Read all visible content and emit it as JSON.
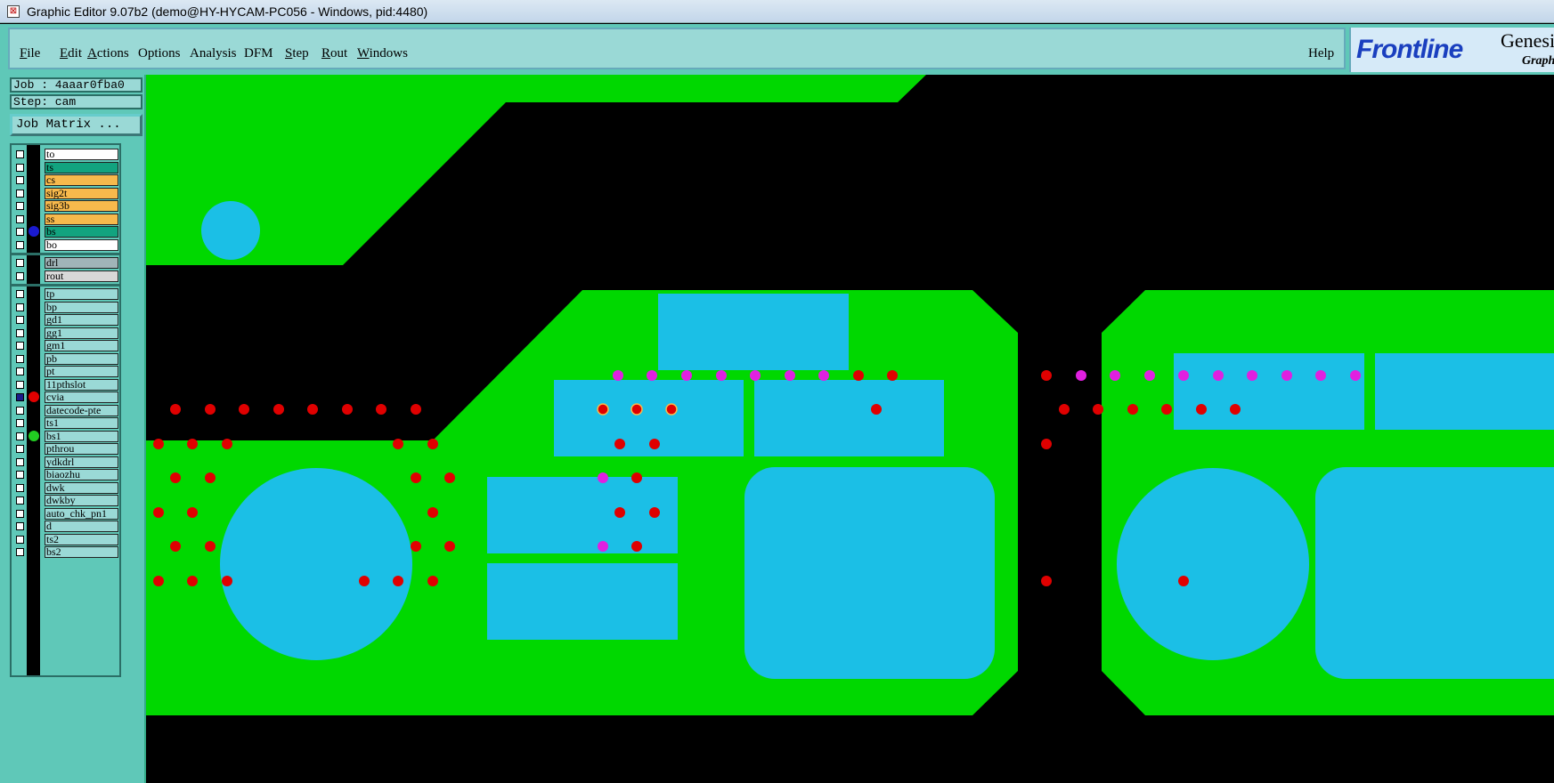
{
  "window": {
    "title": "Graphic Editor 9.07b2 (demo@HY-HYCAM-PC056 - Windows, pid:4480)",
    "icon": "app-icon"
  },
  "menu": {
    "items": [
      {
        "label": "File",
        "ul": "F",
        "rest": "ile"
      },
      {
        "label": "Edit",
        "ul": "E",
        "rest": "dit"
      },
      {
        "label": "Actions",
        "ul": "A",
        "rest": "ctions"
      },
      {
        "label": "Options",
        "ul": "",
        "rest": "Options"
      },
      {
        "label": "Analysis",
        "ul": "",
        "rest": "Analysis"
      },
      {
        "label": "DFM",
        "ul": "",
        "rest": "DFM"
      },
      {
        "label": "Step",
        "ul": "S",
        "rest": "tep"
      },
      {
        "label": "Rout",
        "ul": "R",
        "rest": "out"
      },
      {
        "label": "Windows",
        "ul": "W",
        "rest": "indows"
      }
    ],
    "help": "Help"
  },
  "brand": {
    "logo": "Frontline",
    "product": "Genesis",
    "subtitle": "Graphic"
  },
  "job": {
    "job_label": "Job : 4aaar0fba0",
    "step_label": "Step: cam",
    "matrix_button": "Job Matrix ..."
  },
  "layers": {
    "board": [
      {
        "name": "to",
        "color": "#ffffff"
      },
      {
        "name": "ts",
        "color": "#12a37f"
      },
      {
        "name": "cs",
        "color": "#f7b94c"
      },
      {
        "name": "sig2t",
        "color": "#f7b94c"
      },
      {
        "name": "sig3b",
        "color": "#f7b94c"
      },
      {
        "name": "ss",
        "color": "#f7b94c"
      },
      {
        "name": "bs",
        "color": "#12a37f",
        "dot": "#1a1ad0"
      },
      {
        "name": "bo",
        "color": "#ffffff"
      }
    ],
    "drill": [
      {
        "name": "drl",
        "color": "#a0b4b8"
      },
      {
        "name": "rout",
        "color": "#d8d8d8"
      }
    ],
    "misc": [
      {
        "name": "tp",
        "color": "#9ad9d6"
      },
      {
        "name": "bp",
        "color": "#9ad9d6"
      },
      {
        "name": "gd1",
        "color": "#9ad9d6"
      },
      {
        "name": "gg1",
        "color": "#9ad9d6"
      },
      {
        "name": "gm1",
        "color": "#9ad9d6"
      },
      {
        "name": "pb",
        "color": "#9ad9d6"
      },
      {
        "name": "pt",
        "color": "#9ad9d6"
      },
      {
        "name": "11pthslot",
        "color": "#9ad9d6"
      },
      {
        "name": "cvia",
        "color": "#9ad9d6",
        "dot": "#e00000",
        "checked": true
      },
      {
        "name": "datecode-pte",
        "color": "#9ad9d6"
      },
      {
        "name": "ts1",
        "color": "#9ad9d6"
      },
      {
        "name": "bs1",
        "color": "#9ad9d6",
        "dot": "#22cc22"
      },
      {
        "name": "pthrou",
        "color": "#9ad9d6"
      },
      {
        "name": "ydkdrl",
        "color": "#9ad9d6"
      },
      {
        "name": "biaozhu",
        "color": "#9ad9d6"
      },
      {
        "name": "dwk",
        "color": "#9ad9d6"
      },
      {
        "name": "dwkby",
        "color": "#9ad9d6"
      },
      {
        "name": "auto_chk_pn1",
        "color": "#9ad9d6"
      },
      {
        "name": "d",
        "color": "#9ad9d6"
      },
      {
        "name": "ts2",
        "color": "#9ad9d6"
      },
      {
        "name": "bs2",
        "color": "#9ad9d6"
      }
    ]
  },
  "colors": {
    "background": "#000000",
    "copper": "#00d800",
    "pad": "#1bbfe6",
    "via_red": "#e00000",
    "via_magenta": "#e020e0",
    "panel": "#5fc8b8",
    "menu": "#9ad9d6"
  }
}
